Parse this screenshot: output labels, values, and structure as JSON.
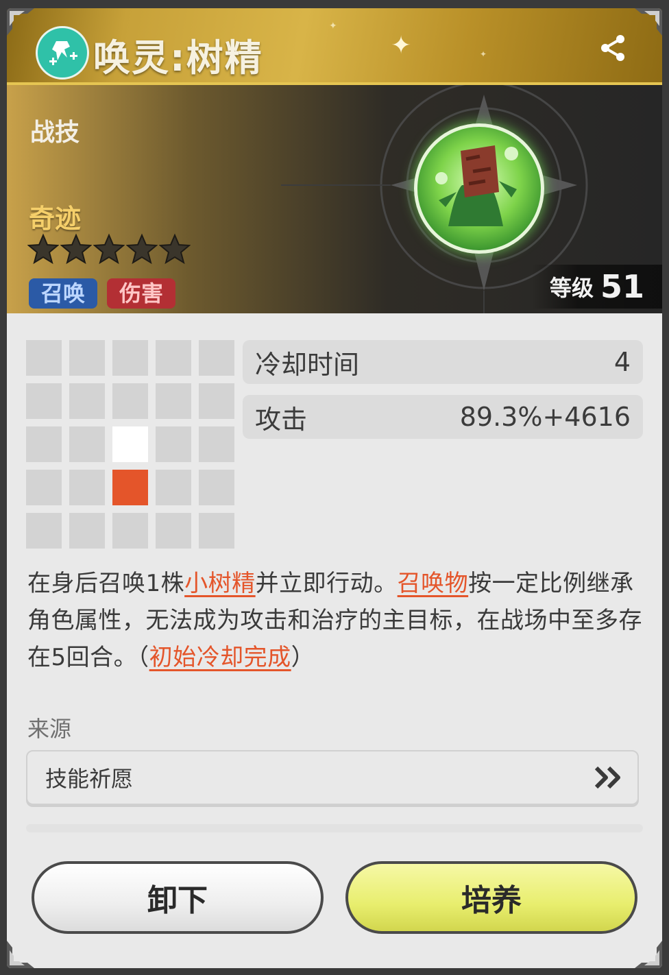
{
  "header": {
    "title": "唤灵:树精"
  },
  "banner": {
    "category": "战技",
    "rarity": "奇迹",
    "stars_total": 5,
    "stars_filled": 0,
    "tags": [
      {
        "label": "召唤",
        "color": "#2b5aa6"
      },
      {
        "label": "伤害",
        "color": "#b32f34"
      }
    ],
    "level_label": "等级",
    "level_value": "51"
  },
  "range_grid": {
    "rows": [
      [
        "empty",
        "empty",
        "empty",
        "empty",
        "empty"
      ],
      [
        "empty",
        "empty",
        "empty",
        "empty",
        "empty"
      ],
      [
        "empty",
        "empty",
        "target",
        "empty",
        "empty"
      ],
      [
        "empty",
        "empty",
        "self",
        "empty",
        "empty"
      ],
      [
        "empty",
        "empty",
        "empty",
        "empty",
        "empty"
      ]
    ],
    "colors": {
      "empty": "#d3d3d3",
      "target": "#ffffff",
      "self": "#e4552a"
    }
  },
  "stats": [
    {
      "label": "冷却时间",
      "value": "4"
    },
    {
      "label": "攻击",
      "value": "89.3%+4616"
    }
  ],
  "description": {
    "p1": "在身后召唤1株",
    "k1": "小树精",
    "p2": "并立即行动。",
    "k2": "召唤物",
    "p3": "按一定比例继承角色属性，无法成为攻击和治疗的主目标，在战场中至多存在5回合。（",
    "k3": "初始冷却完成",
    "p4": "）"
  },
  "source": {
    "label": "来源",
    "item": "技能祈愿"
  },
  "buttons": {
    "unequip": "卸下",
    "train": "培养"
  },
  "icons": [
    "summon-skill-icon",
    "share-icon",
    "star-icon",
    "double-chevron-right-icon"
  ],
  "accent_colors": {
    "keyword": "#e4552a",
    "gold": "#d8b448",
    "train_button": "#e8ee6e"
  }
}
